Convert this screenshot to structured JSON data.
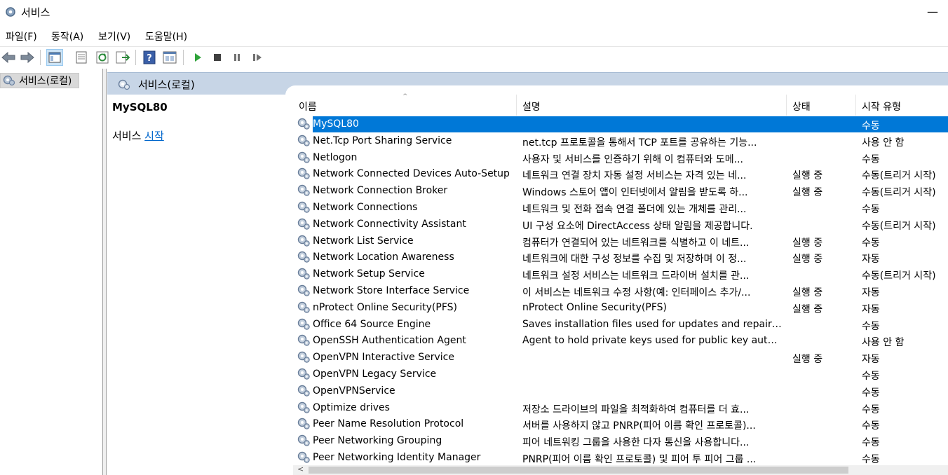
{
  "window": {
    "title": "서비스",
    "minimize_glyph": "—"
  },
  "menu": [
    "파일(F)",
    "동작(A)",
    "보기(V)",
    "도움말(H)"
  ],
  "toolbar_icons": [
    "back-arrow-icon",
    "forward-arrow-icon",
    "console-tree-icon",
    "properties-icon",
    "refresh-icon",
    "export-list-icon",
    "help-icon",
    "show-hide-icon",
    "play-icon",
    "stop-icon",
    "pause-icon",
    "resume-icon"
  ],
  "tree": {
    "root_label": "서비스(로컬)"
  },
  "content": {
    "header_label": "서비스(로컬)"
  },
  "detail": {
    "service_name": "MySQL80",
    "action_prefix": "서비스 ",
    "action_link": "시작"
  },
  "columns": {
    "name": "이름",
    "description": "설명",
    "status": "상태",
    "startup": "시작 유형"
  },
  "services": [
    {
      "name": "MySQL80",
      "description": "",
      "status": "",
      "startup": "수동"
    },
    {
      "name": "Net.Tcp Port Sharing Service",
      "description": "net.tcp 프로토콜을 통해서 TCP 포트를 공유하는 기능...",
      "status": "",
      "startup": "사용 안 함"
    },
    {
      "name": "Netlogon",
      "description": "사용자 및 서비스를 인증하기 위해 이 컴퓨터와 도메...",
      "status": "",
      "startup": "수동"
    },
    {
      "name": "Network Connected Devices Auto-Setup",
      "description": "네트워크 연결 장치 자동 설정 서비스는 자격 있는 네...",
      "status": "실행 중",
      "startup": "수동(트리거 시작)"
    },
    {
      "name": "Network Connection Broker",
      "description": "Windows 스토어 앱이 인터넷에서 알림을 받도록 하...",
      "status": "실행 중",
      "startup": "수동(트리거 시작)"
    },
    {
      "name": "Network Connections",
      "description": "네트워크 및 전화 접속 연결 폴더에 있는 개체를 관리...",
      "status": "",
      "startup": "수동"
    },
    {
      "name": "Network Connectivity Assistant",
      "description": "UI 구성 요소에 DirectAccess 상태 알림을 제공합니다.",
      "status": "",
      "startup": "수동(트리거 시작)"
    },
    {
      "name": "Network List Service",
      "description": "컴퓨터가 연결되어 있는 네트워크를 식별하고 이 네트...",
      "status": "실행 중",
      "startup": "수동"
    },
    {
      "name": "Network Location Awareness",
      "description": "네트워크에 대한 구성 정보를 수집 및 저장하며 이 정...",
      "status": "실행 중",
      "startup": "자동"
    },
    {
      "name": "Network Setup Service",
      "description": "네트워크 설정 서비스는 네트워크 드라이버 설치를 관...",
      "status": "",
      "startup": "수동(트리거 시작)"
    },
    {
      "name": "Network Store Interface Service",
      "description": "이 서비스는 네트워크 수정 사항(예: 인터페이스 추가/...",
      "status": "실행 중",
      "startup": "자동"
    },
    {
      "name": "nProtect Online Security(PFS)",
      "description": "nProtect Online Security(PFS)",
      "status": "실행 중",
      "startup": "자동"
    },
    {
      "name": "Office 64 Source Engine",
      "description": "Saves installation files used for updates and repairs a...",
      "status": "",
      "startup": "수동"
    },
    {
      "name": "OpenSSH Authentication Agent",
      "description": "Agent to hold private keys used for public key authe...",
      "status": "",
      "startup": "사용 안 함"
    },
    {
      "name": "OpenVPN Interactive Service",
      "description": "",
      "status": "실행 중",
      "startup": "자동"
    },
    {
      "name": "OpenVPN Legacy Service",
      "description": "",
      "status": "",
      "startup": "수동"
    },
    {
      "name": "OpenVPNService",
      "description": "",
      "status": "",
      "startup": "수동"
    },
    {
      "name": "Optimize drives",
      "description": "저장소 드라이브의 파일을 최적화하여 컴퓨터를 더 효...",
      "status": "",
      "startup": "수동"
    },
    {
      "name": "Peer Name Resolution Protocol",
      "description": "서버를 사용하지 않고 PNRP(피어 이름 확인 프로토콜)...",
      "status": "",
      "startup": "수동"
    },
    {
      "name": "Peer Networking Grouping",
      "description": "피어 네트워킹 그룹을 사용한 다자 통신을 사용합니다...",
      "status": "",
      "startup": "수동"
    },
    {
      "name": "Peer Networking Identity Manager",
      "description": "PNRP(피어 이름 확인 프로토콜) 및 피어 투 피어 그룹 ...",
      "status": "",
      "startup": "수동"
    }
  ],
  "colors": {
    "selection": "#0078d7",
    "header_band": "#c7d5e6",
    "link": "#0066cc"
  }
}
